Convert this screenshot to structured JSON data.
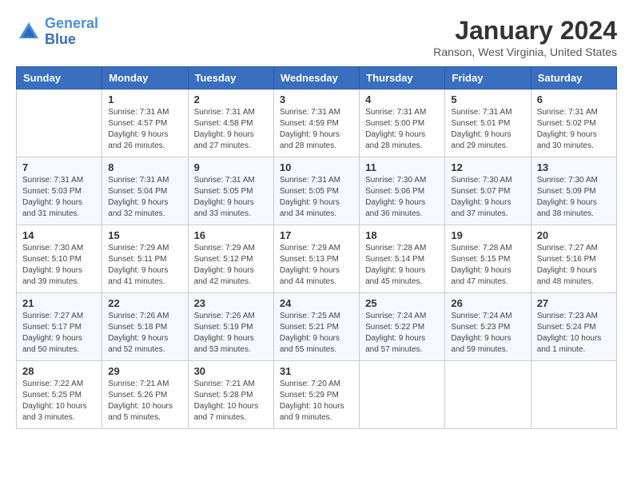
{
  "header": {
    "logo_line1": "General",
    "logo_line2": "Blue",
    "title": "January 2024",
    "subtitle": "Ranson, West Virginia, United States"
  },
  "weekdays": [
    "Sunday",
    "Monday",
    "Tuesday",
    "Wednesday",
    "Thursday",
    "Friday",
    "Saturday"
  ],
  "weeks": [
    [
      {
        "day": "",
        "info": ""
      },
      {
        "day": "1",
        "info": "Sunrise: 7:31 AM\nSunset: 4:57 PM\nDaylight: 9 hours\nand 26 minutes."
      },
      {
        "day": "2",
        "info": "Sunrise: 7:31 AM\nSunset: 4:58 PM\nDaylight: 9 hours\nand 27 minutes."
      },
      {
        "day": "3",
        "info": "Sunrise: 7:31 AM\nSunset: 4:59 PM\nDaylight: 9 hours\nand 28 minutes."
      },
      {
        "day": "4",
        "info": "Sunrise: 7:31 AM\nSunset: 5:00 PM\nDaylight: 9 hours\nand 28 minutes."
      },
      {
        "day": "5",
        "info": "Sunrise: 7:31 AM\nSunset: 5:01 PM\nDaylight: 9 hours\nand 29 minutes."
      },
      {
        "day": "6",
        "info": "Sunrise: 7:31 AM\nSunset: 5:02 PM\nDaylight: 9 hours\nand 30 minutes."
      }
    ],
    [
      {
        "day": "7",
        "info": "Sunrise: 7:31 AM\nSunset: 5:03 PM\nDaylight: 9 hours\nand 31 minutes."
      },
      {
        "day": "8",
        "info": "Sunrise: 7:31 AM\nSunset: 5:04 PM\nDaylight: 9 hours\nand 32 minutes."
      },
      {
        "day": "9",
        "info": "Sunrise: 7:31 AM\nSunset: 5:05 PM\nDaylight: 9 hours\nand 33 minutes."
      },
      {
        "day": "10",
        "info": "Sunrise: 7:31 AM\nSunset: 5:05 PM\nDaylight: 9 hours\nand 34 minutes."
      },
      {
        "day": "11",
        "info": "Sunrise: 7:30 AM\nSunset: 5:06 PM\nDaylight: 9 hours\nand 36 minutes."
      },
      {
        "day": "12",
        "info": "Sunrise: 7:30 AM\nSunset: 5:07 PM\nDaylight: 9 hours\nand 37 minutes."
      },
      {
        "day": "13",
        "info": "Sunrise: 7:30 AM\nSunset: 5:09 PM\nDaylight: 9 hours\nand 38 minutes."
      }
    ],
    [
      {
        "day": "14",
        "info": "Sunrise: 7:30 AM\nSunset: 5:10 PM\nDaylight: 9 hours\nand 39 minutes."
      },
      {
        "day": "15",
        "info": "Sunrise: 7:29 AM\nSunset: 5:11 PM\nDaylight: 9 hours\nand 41 minutes."
      },
      {
        "day": "16",
        "info": "Sunrise: 7:29 AM\nSunset: 5:12 PM\nDaylight: 9 hours\nand 42 minutes."
      },
      {
        "day": "17",
        "info": "Sunrise: 7:29 AM\nSunset: 5:13 PM\nDaylight: 9 hours\nand 44 minutes."
      },
      {
        "day": "18",
        "info": "Sunrise: 7:28 AM\nSunset: 5:14 PM\nDaylight: 9 hours\nand 45 minutes."
      },
      {
        "day": "19",
        "info": "Sunrise: 7:28 AM\nSunset: 5:15 PM\nDaylight: 9 hours\nand 47 minutes."
      },
      {
        "day": "20",
        "info": "Sunrise: 7:27 AM\nSunset: 5:16 PM\nDaylight: 9 hours\nand 48 minutes."
      }
    ],
    [
      {
        "day": "21",
        "info": "Sunrise: 7:27 AM\nSunset: 5:17 PM\nDaylight: 9 hours\nand 50 minutes."
      },
      {
        "day": "22",
        "info": "Sunrise: 7:26 AM\nSunset: 5:18 PM\nDaylight: 9 hours\nand 52 minutes."
      },
      {
        "day": "23",
        "info": "Sunrise: 7:26 AM\nSunset: 5:19 PM\nDaylight: 9 hours\nand 53 minutes."
      },
      {
        "day": "24",
        "info": "Sunrise: 7:25 AM\nSunset: 5:21 PM\nDaylight: 9 hours\nand 55 minutes."
      },
      {
        "day": "25",
        "info": "Sunrise: 7:24 AM\nSunset: 5:22 PM\nDaylight: 9 hours\nand 57 minutes."
      },
      {
        "day": "26",
        "info": "Sunrise: 7:24 AM\nSunset: 5:23 PM\nDaylight: 9 hours\nand 59 minutes."
      },
      {
        "day": "27",
        "info": "Sunrise: 7:23 AM\nSunset: 5:24 PM\nDaylight: 10 hours\nand 1 minute."
      }
    ],
    [
      {
        "day": "28",
        "info": "Sunrise: 7:22 AM\nSunset: 5:25 PM\nDaylight: 10 hours\nand 3 minutes."
      },
      {
        "day": "29",
        "info": "Sunrise: 7:21 AM\nSunset: 5:26 PM\nDaylight: 10 hours\nand 5 minutes."
      },
      {
        "day": "30",
        "info": "Sunrise: 7:21 AM\nSunset: 5:28 PM\nDaylight: 10 hours\nand 7 minutes."
      },
      {
        "day": "31",
        "info": "Sunrise: 7:20 AM\nSunset: 5:29 PM\nDaylight: 10 hours\nand 9 minutes."
      },
      {
        "day": "",
        "info": ""
      },
      {
        "day": "",
        "info": ""
      },
      {
        "day": "",
        "info": ""
      }
    ]
  ]
}
